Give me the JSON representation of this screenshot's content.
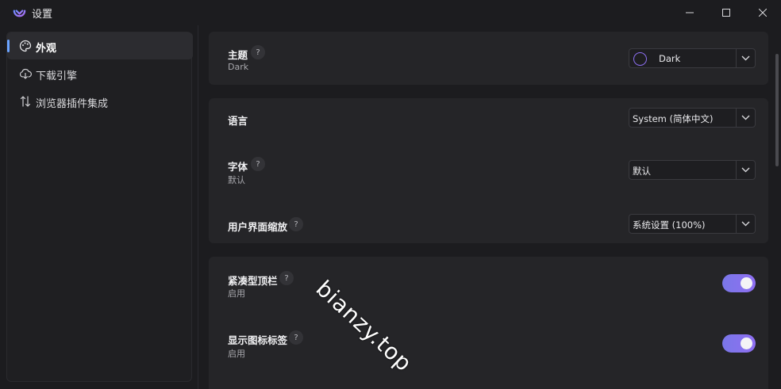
{
  "window": {
    "title": "设置"
  },
  "sidebar": {
    "items": [
      {
        "label": "外观",
        "icon": "palette-icon",
        "active": true
      },
      {
        "label": "下载引擎",
        "icon": "cloud-download-icon",
        "active": false
      },
      {
        "label": "浏览器插件集成",
        "icon": "arrows-up-down-icon",
        "active": false
      }
    ]
  },
  "settings": {
    "theme": {
      "label": "主题",
      "sub": "Dark",
      "help": "?",
      "value": "Dark"
    },
    "language": {
      "label": "语言",
      "value": "System (简体中文)"
    },
    "font": {
      "label": "字体",
      "sub": "默认",
      "help": "?",
      "value": "默认"
    },
    "ui_scale": {
      "label": "用户界面缩放",
      "help": "?",
      "value": "系统设置 (100%)"
    },
    "compact_topbar": {
      "label": "紧凑型顶栏",
      "sub": "启用",
      "help": "?",
      "enabled": true
    },
    "show_icon_labels": {
      "label": "显示图标标签",
      "sub": "启用",
      "help": "?",
      "enabled": true
    }
  },
  "watermark": "bianzy.top",
  "colors": {
    "accent": "#8c6ff0",
    "toggle_on": "#7f74ec",
    "nav_indicator": "#6aa3ff"
  }
}
